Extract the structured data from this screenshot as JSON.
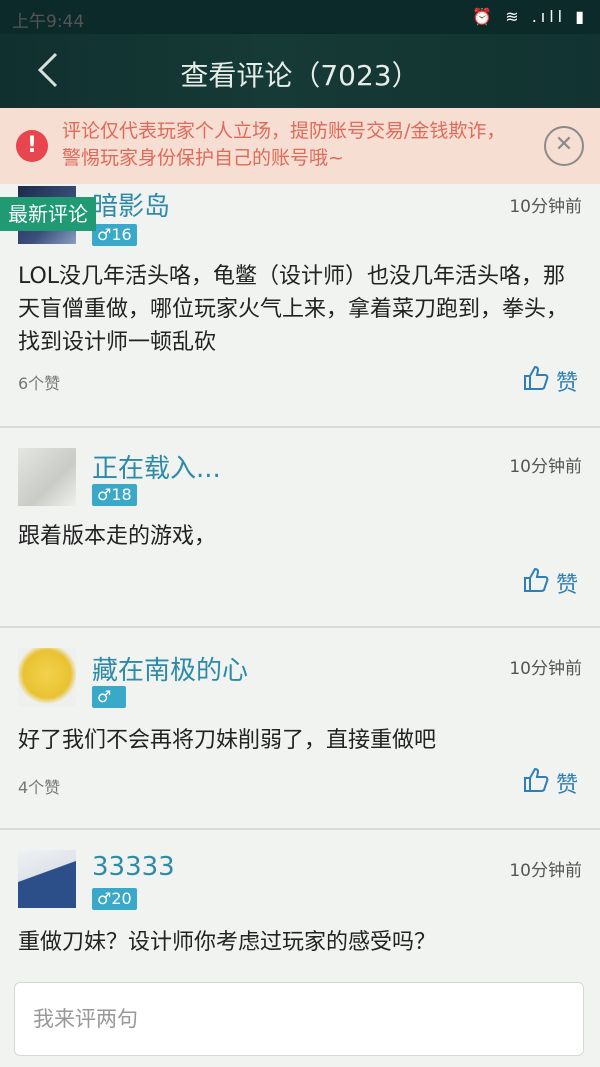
{
  "status_bar": {
    "time": "上午9:44",
    "icons": "⏰ ≋ .ıll ▮"
  },
  "header": {
    "title": "查看评论（7023）"
  },
  "notice": {
    "text": "评论仅代表玩家个人立场，提防账号交易/金钱欺诈，警惕玩家身份保护自己的账号哦~",
    "warn_symbol": "!",
    "close_symbol": "✕"
  },
  "section_badge": "最新评论",
  "comments": [
    {
      "username": "暗影岛",
      "gender_level": "♂16",
      "time": "10分钟前",
      "content": "LOL没几年活头咯，龟鳖（设计师）也没几年活头咯，那天盲僧重做，哪位玩家火气上来，拿着菜刀跑到，拳头，找到设计师一顿乱砍",
      "likes": "6个赞",
      "like_label": "赞"
    },
    {
      "username": "正在载入...",
      "gender_level": "♂18",
      "time": "10分钟前",
      "content": "跟着版本走的游戏，",
      "likes": "",
      "like_label": "赞"
    },
    {
      "username": "藏在南极的心",
      "gender_level": "♂",
      "time": "10分钟前",
      "content": "好了我们不会再将刀妹削弱了，直接重做吧",
      "likes": "4个赞",
      "like_label": "赞"
    },
    {
      "username": "33333",
      "gender_level": "♂20",
      "time": "10分钟前",
      "content": "重做刀妹？设计师你考虑过玩家的感受吗？",
      "likes": "",
      "like_label": "赞"
    }
  ],
  "input": {
    "placeholder": "我来评两句"
  },
  "colors": {
    "header_bg": "#123331",
    "accent": "#2d8aa8",
    "badge_green": "#1f9a73",
    "warn_red": "#e8454e"
  }
}
